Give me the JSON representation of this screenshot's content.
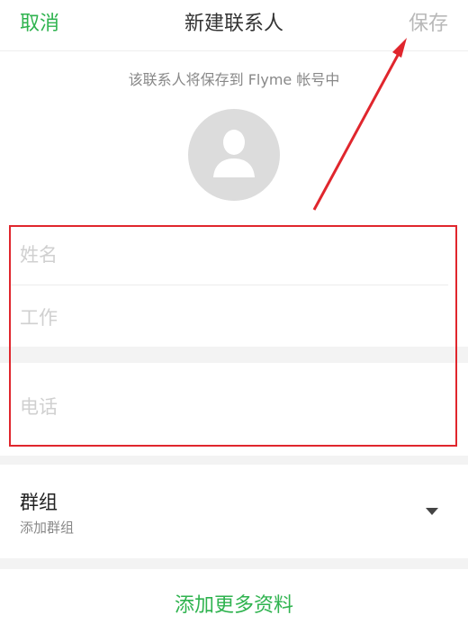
{
  "header": {
    "cancel_label": "取消",
    "title": "新建联系人",
    "save_label": "保存"
  },
  "account_note": "该联系人将保存到 Flyme 帐号中",
  "form": {
    "name_placeholder": "姓名",
    "job_placeholder": "工作",
    "phone_placeholder": "电话"
  },
  "group": {
    "label": "群组",
    "sublabel": "添加群组"
  },
  "add_more_label": "添加更多资料",
  "colors": {
    "accent": "#2fb34f",
    "annotation": "#e0262d",
    "disabled": "#b8b8b8"
  }
}
